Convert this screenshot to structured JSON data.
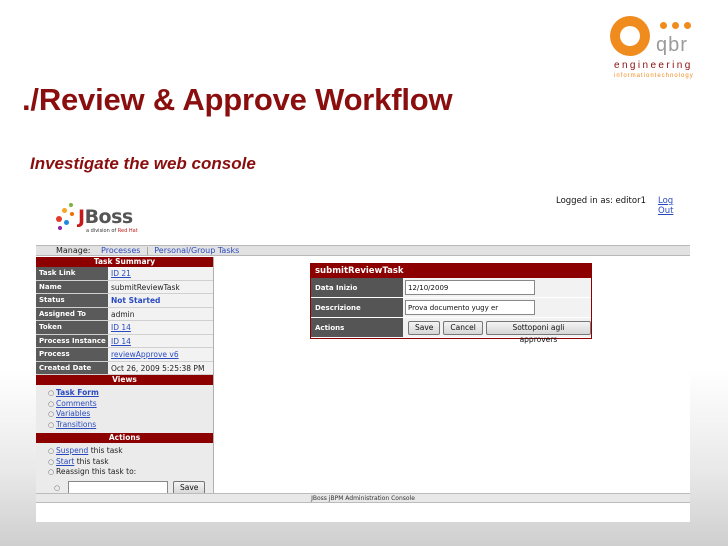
{
  "slide": {
    "title": "./Review & Approve Workflow",
    "subtitle": "Investigate the web console"
  },
  "logo": {
    "wordmark": "qbr",
    "line1": "engineering",
    "line2": "informationtechnology",
    "accent_color": "#f08c1e",
    "brand_color": "#8a0e0e"
  },
  "console": {
    "logged_in": "Logged in as: editor1",
    "logout": "Log Out",
    "jboss": {
      "word_j": "J",
      "word_rest": "Boss",
      "tag_prefix": "a division of",
      "tag_brand": "Red Hat"
    },
    "nav": {
      "label": "Manage:",
      "items": [
        "Processes",
        "Personal/Group Tasks"
      ]
    },
    "task_summary": {
      "header": "Task Summary",
      "rows": [
        {
          "key": "Task Link",
          "value": "ID 21"
        },
        {
          "key": "Name",
          "value": "submitReviewTask"
        },
        {
          "key": "Status",
          "value": "Not Started"
        },
        {
          "key": "Assigned To",
          "value": "admin"
        },
        {
          "key": "Token",
          "value": "ID 14"
        },
        {
          "key": "Process Instance",
          "value": "ID 14"
        },
        {
          "key": "Process",
          "value": "reviewApprove v6"
        },
        {
          "key": "Created Date",
          "value": "Oct 26, 2009 5:25:38 PM"
        }
      ]
    },
    "views": {
      "header": "Views",
      "items": [
        "Task Form",
        "Comments",
        "Variables",
        "Transitions"
      ]
    },
    "actions": {
      "header": "Actions",
      "suspend_link": "Suspend",
      "suspend_rest": " this task",
      "start_link": "Start",
      "start_rest": " this task",
      "reassign": "Reassign this task to:",
      "reassign_value": "",
      "save": "Save"
    },
    "form": {
      "title": "submitReviewTask",
      "data_inizio_label": "Data Inizio",
      "data_inizio_value": "12/10/2009",
      "descrizione_label": "Descrizione",
      "descrizione_value": "Prova documento yugy er",
      "actions_label": "Actions",
      "buttons": [
        "Save",
        "Cancel",
        "Sottoponi agli approvers"
      ]
    },
    "footer": "JBoss jBPM Administration Console"
  }
}
